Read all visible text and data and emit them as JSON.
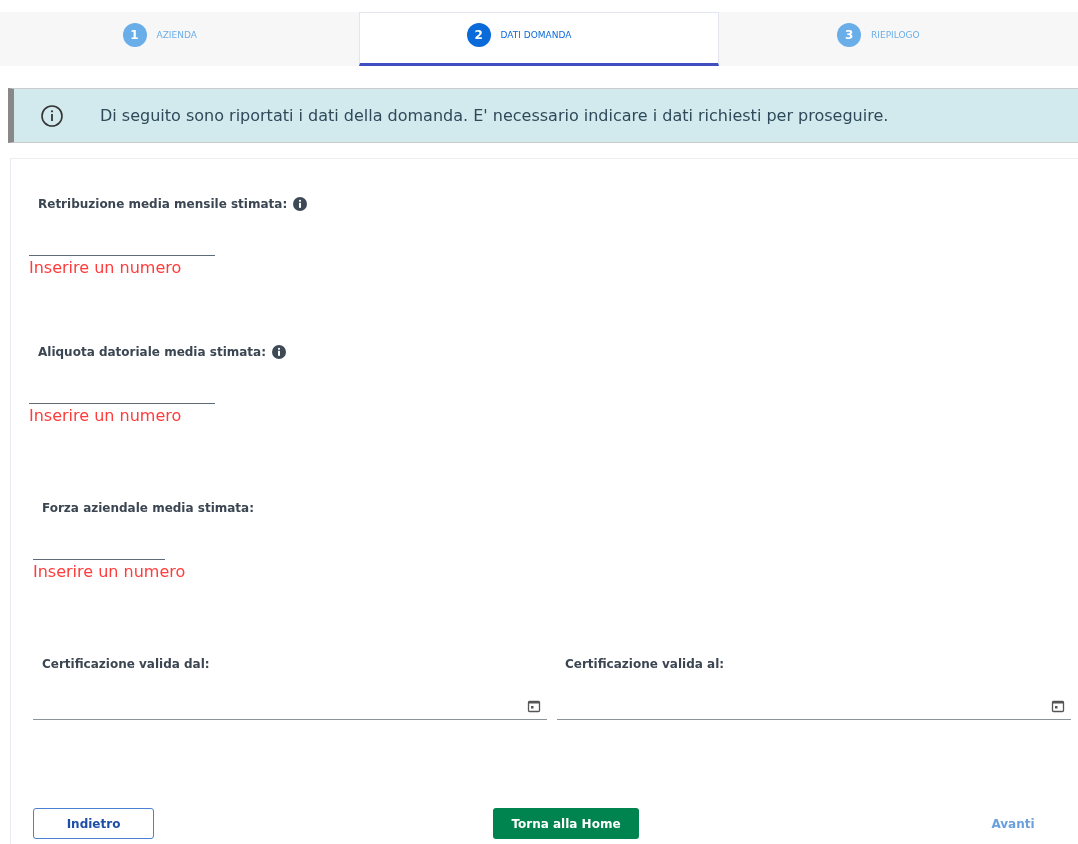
{
  "steps": [
    {
      "number": "1",
      "label": "AZIENDA",
      "selected": false
    },
    {
      "number": "2",
      "label": "DATI DOMANDA",
      "selected": true
    },
    {
      "number": "3",
      "label": "RIEPILOGO",
      "selected": false
    }
  ],
  "alert": {
    "text": "Di seguito sono riportati i dati della domanda. E' necessario indicare i dati richiesti per proseguire."
  },
  "fields": [
    {
      "label": "Retribuzione media mensile stimata:",
      "info": true,
      "error": "Inserire un numero"
    },
    {
      "label": "Aliquota datoriale media stimata:",
      "info": true,
      "error": "Inserire un numero"
    },
    {
      "label": "Forza aziendale media stimata:",
      "info": false,
      "error": "Inserire un numero"
    }
  ],
  "date_fields": [
    {
      "label": "Certificazione valida dal:"
    },
    {
      "label": "Certificazione valida al:"
    }
  ],
  "buttons": [
    {
      "label": "Indietro",
      "kind": "outline"
    },
    {
      "label": "Torna alla Home",
      "kind": "primary"
    },
    {
      "label": "Avanti",
      "kind": "link"
    }
  ]
}
